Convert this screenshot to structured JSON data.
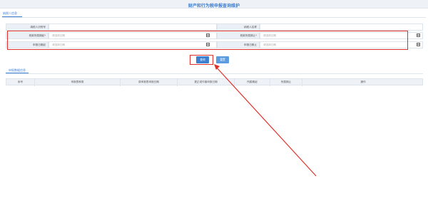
{
  "page": {
    "title": "财产和行为税申报查询维护"
  },
  "section1": {
    "tab_label": "纳税人信息"
  },
  "form": {
    "row1": {
      "label_left": "纳税人识别号",
      "value_left": "",
      "label_right": "纳税人名称",
      "value_right": ""
    },
    "row2": {
      "label_left": "税款所属期起",
      "placeholder_left": "请选择日期",
      "label_right": "税款所属期止",
      "placeholder_right": "请选择日期"
    },
    "row3": {
      "label_left": "申报日期起",
      "placeholder_left": "请选择日期",
      "label_right": "申报日期止",
      "placeholder_right": "请选择日期"
    },
    "required_mark": "*"
  },
  "buttons": {
    "query": "查询",
    "reset": "重置"
  },
  "section2": {
    "tab_label": "申报数据信息"
  },
  "table": {
    "headers": [
      "序号",
      "申报表种类",
      "原申报表申报日期",
      "更正或作废申报日期",
      "所属期起",
      "所属期止",
      "操作"
    ]
  },
  "colors": {
    "accent": "#3d7fd1",
    "highlight": "#e0302a"
  }
}
